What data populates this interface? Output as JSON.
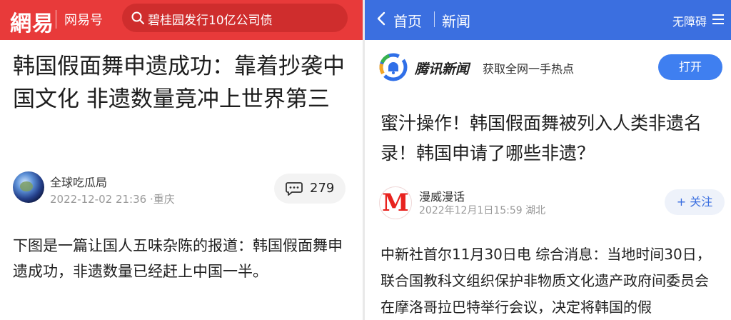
{
  "netease": {
    "logo": "網易",
    "channel": "网易号",
    "search": {
      "query": "碧桂园发行10亿公司债"
    },
    "article": {
      "title": "韩国假面舞申遗成功：靠着抄袭中国文化 非遗数量竟冲上世界第三",
      "author": "全球吃瓜局",
      "timestamp": "2022-12-02 21:36",
      "location": "·重庆",
      "comment_count": "279",
      "body": "下图是一篇让国人五味杂陈的报道：韩国假面舞申遗成功，非遗数量已经赶上中国一半。"
    },
    "colors": {
      "brand": "#e83a3a"
    },
    "icons": {
      "search": "search-icon",
      "comment": "comment-icon"
    }
  },
  "tencent": {
    "nav": {
      "back": "首页",
      "current": "新闻",
      "accessibility": "无障碍"
    },
    "banner": {
      "brand": "腾讯新闻",
      "slogan": "获取全网一手热点",
      "open_button": "打开"
    },
    "article": {
      "title": "蜜汁操作！韩国假面舞被列入人类非遗名录！韩国申请了哪些非遗？",
      "author": "漫威漫话",
      "avatar_letter": "M",
      "timestamp": "2022年12月1日15:59",
      "location": "湖北",
      "follow_button": "+ 关注",
      "body": "中新社首尔11月30日电 综合消息：当地时间30日，联合国教科文组织保护非物质文化遗产政府间委员会在摩洛哥拉巴特举行会议，决定将韩国的假"
    },
    "colors": {
      "brand": "#3b6fe0",
      "button": "#3f7ff0"
    },
    "icons": {
      "back": "chevron-left-icon",
      "menu": "menu-icon",
      "logo": "tencent-news-logo-icon"
    }
  }
}
